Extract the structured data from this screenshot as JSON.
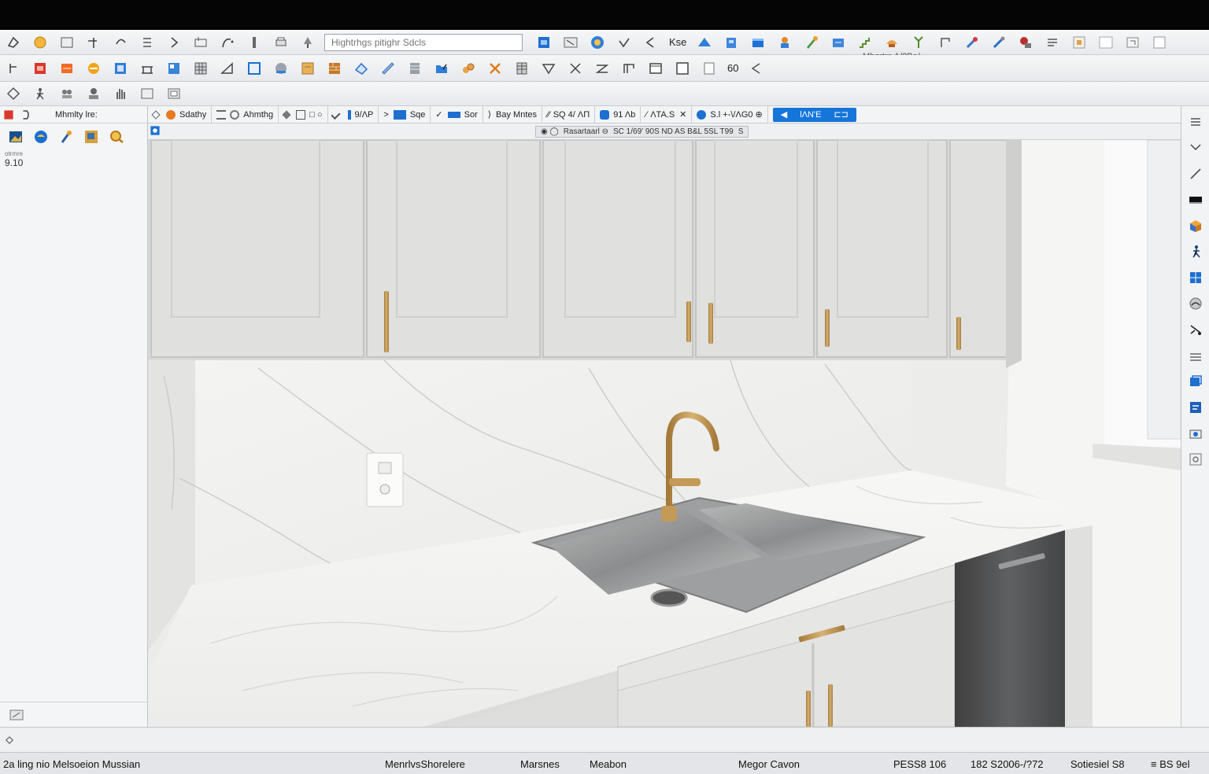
{
  "app": {
    "search_placeholder": "Hightrhgs pitighr Sdcls",
    "toolbar1_label": "Kse",
    "sub_label": "Mhgrtrs A/?Be/",
    "toolbar2_field": "60"
  },
  "left_panel": {
    "title": "Mhmlty lre:",
    "tiny_label": "otrmre",
    "value": "9.10"
  },
  "props": [
    {
      "label": "Sdathy"
    },
    {
      "label": "Ahmthg"
    },
    {
      "label": "□ ○"
    },
    {
      "label": "9/ΛP"
    },
    {
      "label": "Sqe"
    },
    {
      "label": "Sor"
    },
    {
      "label": "Bay Mntes"
    },
    {
      "label": "SQ 4/ ΛΠ"
    },
    {
      "label": "91 Λb"
    },
    {
      "label": "ΛTA.S"
    },
    {
      "label": "S.l +-\\/ΛG0 ⊕"
    }
  ],
  "primary_button": {
    "label": "lΛN'E",
    "side": "⊏⊐"
  },
  "viewport": {
    "tab_label": "Rasartaarl ⊖",
    "tab_info": "SC 1/69' 90S ND AS B&L 5SL T99"
  },
  "status": {
    "left": "2a ling nio Melsoeion Mussian",
    "s1": "MenrlvsShorelere",
    "s2": "Marsnes",
    "s3": "Meabon",
    "s4": "Megor Cavon",
    "s5": "PESS8 106",
    "s6": "182 S2006-/?72",
    "s7": "Sotiesiel S8",
    "s8": "≡ BS 9el"
  },
  "colors": {
    "accent": "#1675d9",
    "brass": "#c39a58",
    "cabinet": "#dcdcdc"
  }
}
